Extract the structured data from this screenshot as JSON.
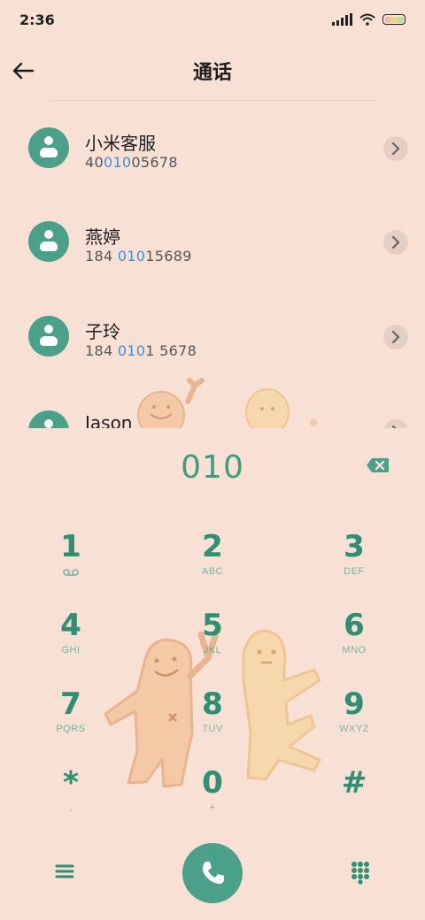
{
  "status_bar": {
    "time": "2:36"
  },
  "header": {
    "title": "通话",
    "back_icon": "arrow-left-icon"
  },
  "contacts": [
    {
      "name": "小米客服",
      "number_parts": [
        "40",
        "010",
        "05678"
      ]
    },
    {
      "name": "燕婷",
      "number_parts": [
        "184 ",
        "010",
        "15689"
      ]
    },
    {
      "name": "子玲",
      "number_parts": [
        "184 ",
        "010",
        "1 5678"
      ]
    },
    {
      "name": "Jason",
      "number_parts": [
        "",
        "",
        ""
      ]
    }
  ],
  "dialer": {
    "input": "010",
    "keys": [
      {
        "digit": "1",
        "letters": "voicemail-icon"
      },
      {
        "digit": "2",
        "letters": "ABC"
      },
      {
        "digit": "3",
        "letters": "DEF"
      },
      {
        "digit": "4",
        "letters": "GHI"
      },
      {
        "digit": "5",
        "letters": "JKL"
      },
      {
        "digit": "6",
        "letters": "MNO"
      },
      {
        "digit": "7",
        "letters": "PQRS"
      },
      {
        "digit": "8",
        "letters": "TUV"
      },
      {
        "digit": "9",
        "letters": "WXYZ"
      },
      {
        "digit": "*",
        "letters": ","
      },
      {
        "digit": "0",
        "letters": "+"
      },
      {
        "digit": "#",
        "letters": ""
      }
    ]
  },
  "colors": {
    "background": "#f9e0d4",
    "accent": "#4aa088",
    "highlight": "#3f8ee0"
  }
}
